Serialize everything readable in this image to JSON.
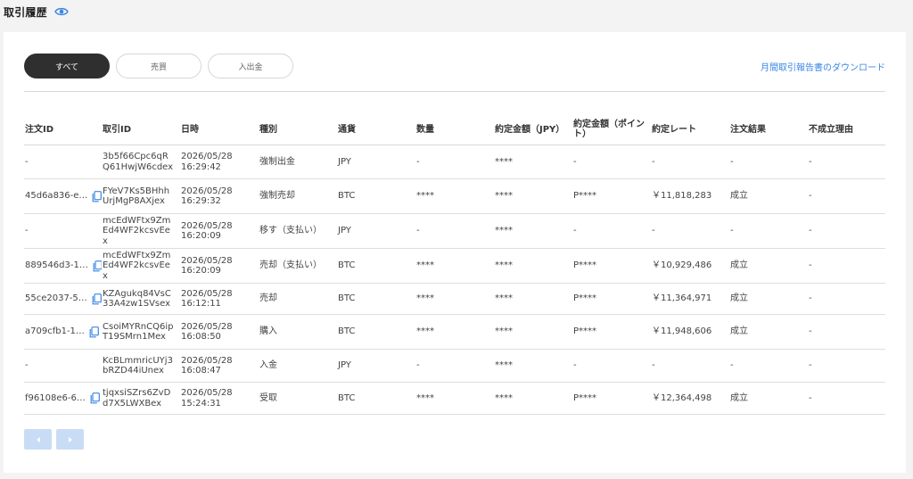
{
  "page": {
    "title": "取引履歴",
    "visibility_icon": "eye-icon"
  },
  "tabs": [
    {
      "label": "すべて",
      "active": true
    },
    {
      "label": "売買",
      "active": false
    },
    {
      "label": "入出金",
      "active": false
    }
  ],
  "download_link": "月間取引報告書のダウンロード",
  "table": {
    "columns": [
      "注文ID",
      "取引ID",
      "日時",
      "種別",
      "通貨",
      "数量",
      "約定金額（JPY）",
      "約定金額（ポイント）",
      "約定レート",
      "注文結果",
      "不成立理由"
    ],
    "rows": [
      {
        "order_id": "-",
        "has_copy": false,
        "tx_id": "3b5f66Cpc6qRQ61HwjW6cdex",
        "date": "2026/05/28",
        "time": "16:29:42",
        "type": "強制出金",
        "currency": "JPY",
        "quantity": "-",
        "amount_jpy": "****",
        "amount_point": "-",
        "rate": "-",
        "result": "-",
        "reason": "-"
      },
      {
        "order_id": "45d6a836-e…",
        "has_copy": true,
        "tx_id": "FYeV7Ks5BHhhUrjMgP8AXjex",
        "date": "2026/05/28",
        "time": "16:29:32",
        "type": "強制売却",
        "currency": "BTC",
        "quantity": "****",
        "amount_jpy": "****",
        "amount_point": "P****",
        "rate": "￥11,818,283",
        "result": "成立",
        "reason": "-"
      },
      {
        "order_id": "-",
        "has_copy": false,
        "tx_id": "mcEdWFtx9ZmEd4WF2kcsvEex",
        "date": "2026/05/28",
        "time": "16:20:09",
        "type": "移す（支払い）",
        "currency": "JPY",
        "quantity": "-",
        "amount_jpy": "****",
        "amount_point": "-",
        "rate": "-",
        "result": "-",
        "reason": "-"
      },
      {
        "order_id": "889546d3-1…",
        "has_copy": true,
        "tx_id": "mcEdWFtx9ZmEd4WF2kcsvEex",
        "date": "2026/05/28",
        "time": "16:20:09",
        "type": "売却（支払い）",
        "currency": "BTC",
        "quantity": "****",
        "amount_jpy": "****",
        "amount_point": "P****",
        "rate": "￥10,929,486",
        "result": "成立",
        "reason": "-"
      },
      {
        "order_id": "55ce2037-5…",
        "has_copy": true,
        "tx_id": "KZAgukq84VsC33A4zw1SVsex",
        "date": "2026/05/28",
        "time": "16:12:11",
        "type": "売却",
        "currency": "BTC",
        "quantity": "****",
        "amount_jpy": "****",
        "amount_point": "P****",
        "rate": "￥11,364,971",
        "result": "成立",
        "reason": "-"
      },
      {
        "order_id": "a709cfb1-1…",
        "has_copy": true,
        "tx_id": "CsoiMYRnCQ6ipT19SMrn1Mex",
        "date": "2026/05/28",
        "time": "16:08:50",
        "type": "購入",
        "currency": "BTC",
        "quantity": "****",
        "amount_jpy": "****",
        "amount_point": "P****",
        "rate": "￥11,948,606",
        "result": "成立",
        "reason": "-"
      },
      {
        "order_id": "-",
        "has_copy": false,
        "tx_id": "KcBLmmricUYj3bRZD44iUnex",
        "date": "2026/05/28",
        "time": "16:08:47",
        "type": "入金",
        "currency": "JPY",
        "quantity": "-",
        "amount_jpy": "****",
        "amount_point": "-",
        "rate": "-",
        "result": "-",
        "reason": "-"
      },
      {
        "order_id": "f96108e6-6…",
        "has_copy": true,
        "tx_id": "tjqxsiSZrs6ZvDd7X5LWXBex",
        "date": "2026/05/28",
        "time": "15:24:31",
        "type": "受取",
        "currency": "BTC",
        "quantity": "****",
        "amount_jpy": "****",
        "amount_point": "P****",
        "rate": "￥12,364,498",
        "result": "成立",
        "reason": "-"
      }
    ]
  },
  "pagination": {
    "prev_icon": "triangle-left-icon",
    "next_icon": "triangle-right-icon"
  },
  "colors": {
    "accent": "#3a86e6",
    "active_tab": "#2f2f2f",
    "pager": "#c9dcf5",
    "background": "#f3f3f3"
  }
}
